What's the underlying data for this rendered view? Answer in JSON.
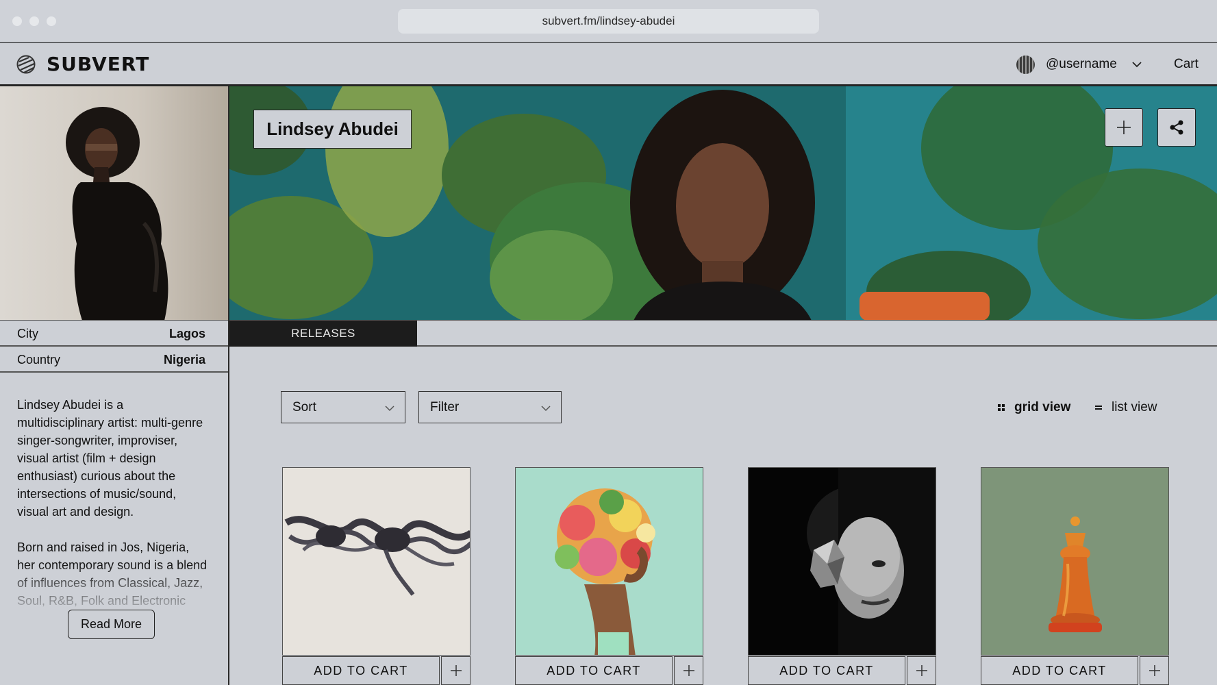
{
  "browser": {
    "url": "subvert.fm/lindsey-abudei"
  },
  "header": {
    "logo_text": "SUBVERT",
    "username": "@username",
    "cart_label": "Cart"
  },
  "artist": {
    "name": "Lindsey Abudei"
  },
  "profile": {
    "city_label": "City",
    "city_value": "Lagos",
    "country_label": "Country",
    "country_value": "Nigeria",
    "bio_p1": "Lindsey Abudei is  a multidisciplinary artist: multi-genre singer-songwriter, improviser, visual artist (film + design enthusiast) curious about the intersections of music/sound, visual art and design.",
    "bio_p2": "Born and raised in Jos, Nigeria, her contemporary sound is a blend of influences from Classical, Jazz, Soul, R&B, Folk and Electronic",
    "read_more": "Read More"
  },
  "tabs": {
    "releases": "RELEASES"
  },
  "toolbar": {
    "sort_label": "Sort",
    "filter_label": "Filter",
    "grid_view": "grid view",
    "list_view": "list view"
  },
  "releases": [
    {
      "add_to_cart": "ADD TO CART",
      "cover": "ribbon-sculpture"
    },
    {
      "add_to_cart": "ADD TO CART",
      "cover": "flower-head"
    },
    {
      "add_to_cart": "ADD TO CART",
      "cover": "half-face-portrait"
    },
    {
      "add_to_cart": "ADD TO CART",
      "cover": "chess-queen"
    }
  ],
  "colors": {
    "panel": "#cdd0d6",
    "ink": "#111111",
    "tab_active": "#1c1c1c"
  }
}
